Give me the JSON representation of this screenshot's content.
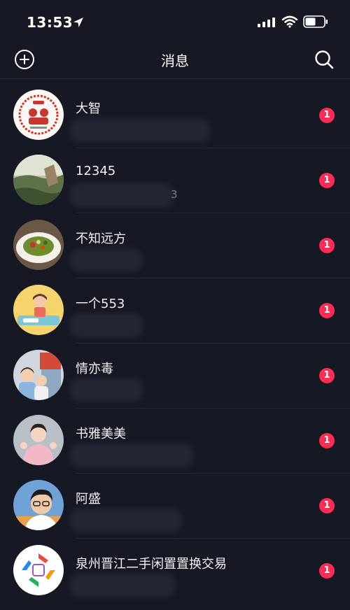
{
  "status_bar": {
    "time": "13:53",
    "icons": [
      "location-arrow-icon",
      "signal-icon",
      "wifi-icon",
      "battery-icon"
    ]
  },
  "header": {
    "title": "消息",
    "left_icon": "add-circle-icon",
    "right_icon": "search-icon"
  },
  "conversations": [
    {
      "name": "大智",
      "unread": "1",
      "preview_tail": ""
    },
    {
      "name": "12345",
      "unread": "1",
      "preview_tail": "3"
    },
    {
      "name": "不知远方",
      "unread": "1",
      "preview_tail": ""
    },
    {
      "name": "一个553",
      "unread": "1",
      "preview_tail": ""
    },
    {
      "name": "情亦毒",
      "unread": "1",
      "preview_tail": ""
    },
    {
      "name": "书雅美美",
      "unread": "1",
      "preview_tail": ""
    },
    {
      "name": "阿盛",
      "unread": "1",
      "preview_tail": ""
    },
    {
      "name": "泉州晋江二手闲置置换交易",
      "unread": "1",
      "preview_tail": ""
    }
  ],
  "colors": {
    "background": "#161823",
    "badge": "#fe2c55",
    "text": "#ffffff"
  }
}
